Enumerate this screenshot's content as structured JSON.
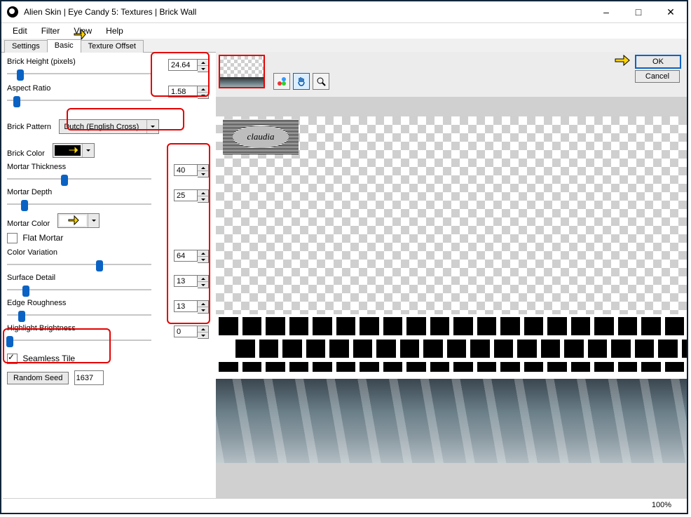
{
  "title": "Alien Skin | Eye Candy 5: Textures | Brick Wall",
  "menu": {
    "edit": "Edit",
    "filter": "Filter",
    "view": "View",
    "help": "Help"
  },
  "tabs": {
    "settings": "Settings",
    "basic": "Basic",
    "texture_offset": "Texture Offset"
  },
  "panel": {
    "brick_height_label": "Brick Height (pixels)",
    "brick_height_value": "24.64",
    "aspect_ratio_label": "Aspect Ratio",
    "aspect_ratio_value": "1.58",
    "brick_pattern_label": "Brick Pattern",
    "brick_pattern_value": "Dutch (English Cross)",
    "brick_color_label": "Brick Color",
    "brick_color_hex": "#000000",
    "mortar_thickness_label": "Mortar Thickness",
    "mortar_thickness_value": "40",
    "mortar_depth_label": "Mortar Depth",
    "mortar_depth_value": "25",
    "mortar_color_label": "Mortar Color",
    "mortar_color_hex": "#ffffff",
    "flat_mortar_label": "Flat Mortar",
    "flat_mortar_checked": false,
    "color_variation_label": "Color Variation",
    "color_variation_value": "64",
    "surface_detail_label": "Surface Detail",
    "surface_detail_value": "13",
    "edge_roughness_label": "Edge Roughness",
    "edge_roughness_value": "13",
    "highlight_brightness_label": "Highlight Brightness",
    "highlight_brightness_value": "0",
    "seamless_tile_label": "Seamless Tile",
    "seamless_tile_checked": true,
    "random_seed_label": "Random Seed",
    "random_seed_value": "1637"
  },
  "buttons": {
    "ok": "OK",
    "cancel": "Cancel"
  },
  "preview_badge": "claudia",
  "zoom": "100%"
}
